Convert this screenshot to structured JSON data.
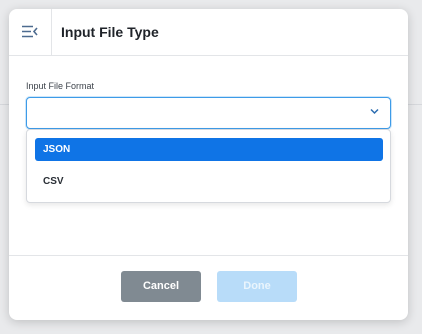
{
  "dialog": {
    "title": "Input File Type",
    "collapse_icon": "collapse-menu-icon"
  },
  "field": {
    "label": "Input File Format",
    "value": "",
    "chevron_icon": "chevron-down-icon",
    "options": [
      {
        "label": "JSON",
        "selected": true
      },
      {
        "label": "CSV",
        "selected": false
      }
    ]
  },
  "footer": {
    "cancel_label": "Cancel",
    "done_label": "Done",
    "done_enabled": false
  },
  "colors": {
    "accent": "#0f74e6",
    "focus_border": "#3d9be8",
    "cancel_bg": "#808a92",
    "done_disabled_bg": "#b8dcf9"
  }
}
